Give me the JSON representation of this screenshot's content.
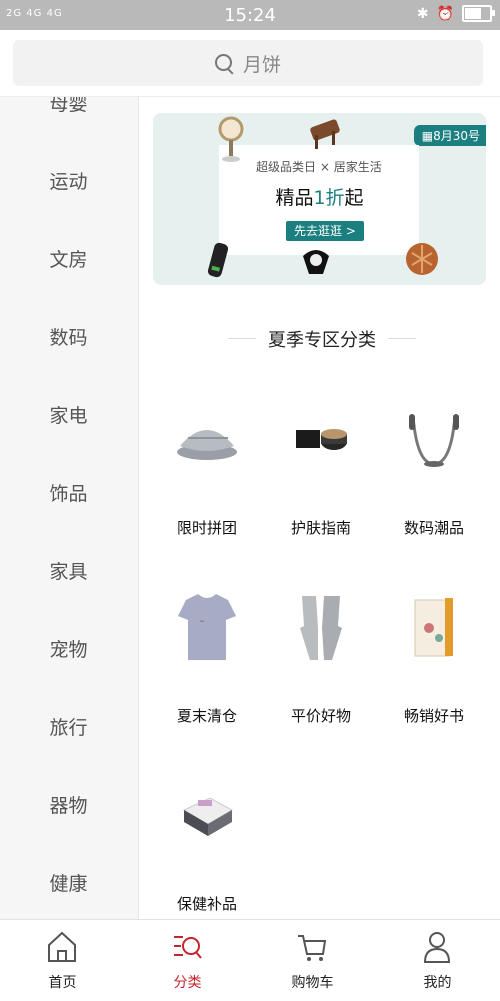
{
  "status_bar": {
    "signal": "2G 4G 4G",
    "time": "15:24",
    "battery_level": 0.6
  },
  "search": {
    "placeholder": "月饼"
  },
  "sidebar": {
    "items": [
      {
        "label": "母婴"
      },
      {
        "label": "运动"
      },
      {
        "label": "文房"
      },
      {
        "label": "数码"
      },
      {
        "label": "家电"
      },
      {
        "label": "饰品"
      },
      {
        "label": "家具"
      },
      {
        "label": "宠物"
      },
      {
        "label": "旅行"
      },
      {
        "label": "器物"
      },
      {
        "label": "健康"
      }
    ]
  },
  "banner": {
    "date_badge": "8月30号",
    "brand": "超级品类日",
    "brand_sep": "×",
    "brand_partner": "居家生活",
    "headline_pre": "精品",
    "headline_accent": "1折",
    "headline_post": "起",
    "button": "先去逛逛 >"
  },
  "section": {
    "title": "夏季专区分类"
  },
  "categories": [
    {
      "label": "限时拼团",
      "icon": "cushion-image"
    },
    {
      "label": "护肤指南",
      "icon": "cream-jar-image"
    },
    {
      "label": "数码潮品",
      "icon": "earphones-image"
    },
    {
      "label": "夏末清仓",
      "icon": "tshirt-image"
    },
    {
      "label": "平价好物",
      "icon": "gloves-image"
    },
    {
      "label": "畅销好书",
      "icon": "books-image"
    },
    {
      "label": "保健补品",
      "icon": "supplement-box-image"
    }
  ],
  "tabbar": {
    "tabs": [
      {
        "label": "首页",
        "icon": "home-icon"
      },
      {
        "label": "分类",
        "icon": "category-icon",
        "active": true
      },
      {
        "label": "购物车",
        "icon": "cart-icon"
      },
      {
        "label": "我的",
        "icon": "profile-icon"
      }
    ]
  },
  "colors": {
    "accent": "#c4262e",
    "banner_teal": "#1b7f80"
  }
}
